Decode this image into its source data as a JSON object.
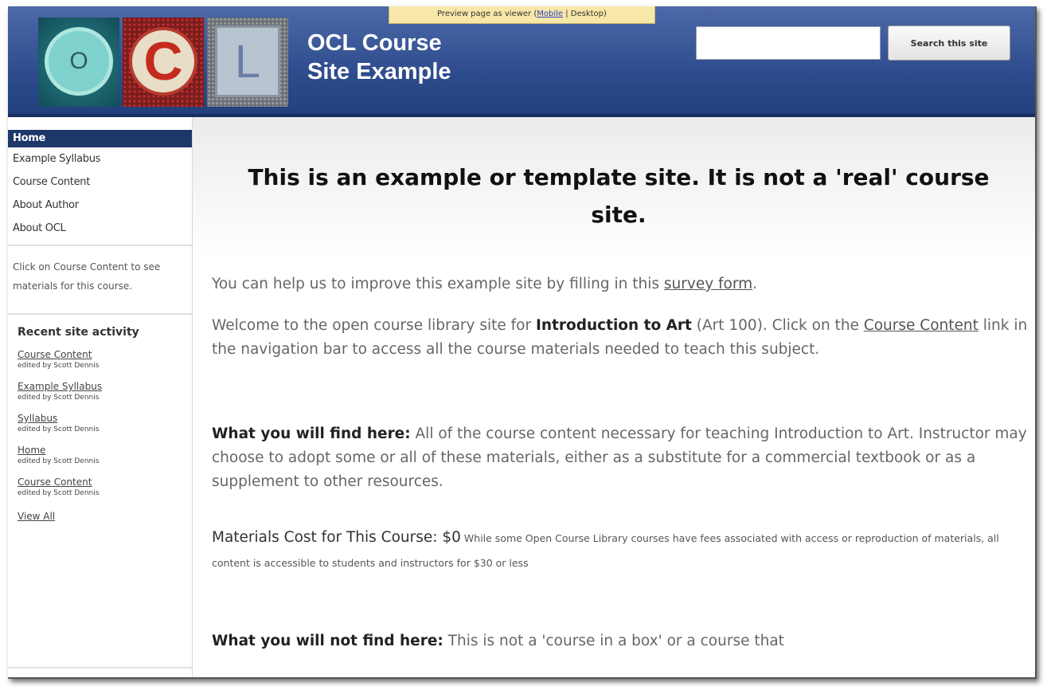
{
  "preview_bar": {
    "prefix": "Preview page as viewer (",
    "mobile": "Mobile",
    "suffix": " | Desktop)"
  },
  "header": {
    "logo_letters": [
      "O",
      "C",
      "L"
    ],
    "title_line1": "OCL Course",
    "title_line2": "Site Example",
    "search_placeholder": "",
    "search_button": "Search this site"
  },
  "sidebar": {
    "nav": [
      "Home",
      "Example Syllabus",
      "Course Content",
      "About Author",
      "About OCL"
    ],
    "note": "Click on Course Content to see materials for this course.",
    "recent_title": "Recent site activity",
    "recent": [
      {
        "page": "Course Content",
        "by": "edited by Scott Dennis"
      },
      {
        "page": "Example Syllabus",
        "by": "edited by Scott Dennis"
      },
      {
        "page": "Syllabus",
        "by": "edited by Scott Dennis"
      },
      {
        "page": "Home",
        "by": "edited by Scott Dennis"
      },
      {
        "page": "Course Content",
        "by": "edited by Scott Dennis"
      }
    ],
    "view_all": "View All"
  },
  "main": {
    "title": "This is an example or template site.  It is not a 'real' course site.",
    "survey_pre": "You can help us to improve this example site by filling in this ",
    "survey_link": "survey form",
    "survey_post": ".",
    "welcome_pre": "Welcome to the open course library site for ",
    "welcome_bold": "Introduction to Art",
    "welcome_mid": " (Art 100).  Click on the ",
    "welcome_link": "Course Content",
    "welcome_post": " link in the navigation bar to access all the course materials needed to teach this subject.",
    "find_label": "What you will find here:",
    "find_text": "  All of the course content necessary for teaching Introduction to Art.  Instructor may choose to adopt some or all of these materials, either as a substitute for a commercial textbook or as a supplement to other resources.",
    "cost_label": "Materials Cost for This Course: ",
    "cost_value": "$0",
    "cost_note": " While some Open Course Library courses have fees associated with access or reproduction of materials, all content is accessible to students and instructors for $30 or less",
    "notfind_label": "What you will not find here:",
    "notfind_text": " This is not a 'course in a box' or a course that"
  }
}
